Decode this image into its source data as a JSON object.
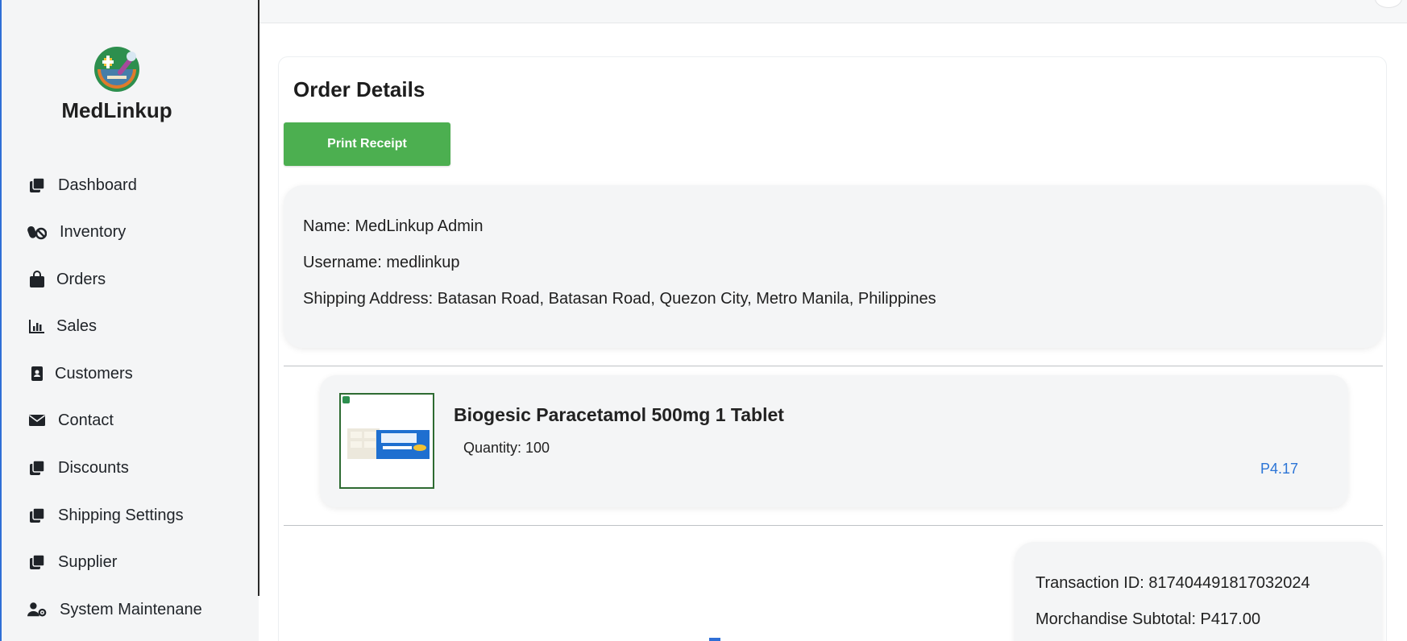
{
  "app": {
    "name": "MedLinkup"
  },
  "sidebar": {
    "items": [
      {
        "label": "Dashboard",
        "icon": "dashboard-icon"
      },
      {
        "label": "Inventory",
        "icon": "pills-icon"
      },
      {
        "label": "Orders",
        "icon": "shopping-bag-icon"
      },
      {
        "label": "Sales",
        "icon": "bar-chart-icon"
      },
      {
        "label": "Customers",
        "icon": "address-book-icon"
      },
      {
        "label": "Contact",
        "icon": "envelope-icon"
      },
      {
        "label": "Discounts",
        "icon": "stack-icon"
      },
      {
        "label": "Shipping Settings",
        "icon": "stack-icon"
      },
      {
        "label": "Supplier",
        "icon": "stack-icon"
      },
      {
        "label": "System Maintenane",
        "icon": "user-gear-icon"
      }
    ]
  },
  "main": {
    "title": "Order Details",
    "print_button_label": "Print Receipt"
  },
  "customer": {
    "name_line": "Name: MedLinkup Admin",
    "username_line": "Username: medlinkup",
    "address_line": "Shipping Address: Batasan Road, Batasan Road, Quezon City, Metro Manila, Philippines"
  },
  "order_items": [
    {
      "name": "Biogesic Paracetamol 500mg 1 Tablet",
      "quantity_line": "Quantity: 100",
      "price": "P4.17"
    }
  ],
  "summary": {
    "transaction_line": "Transaction ID: 817404491817032024",
    "subtotal_line": "Morchandise Subtotal: P417.00"
  },
  "colors": {
    "accent_green": "#4caf50",
    "price_blue": "#2b74d6",
    "edge_blue": "#2f6fd6",
    "sidebar_bg": "#f4f5f6"
  }
}
